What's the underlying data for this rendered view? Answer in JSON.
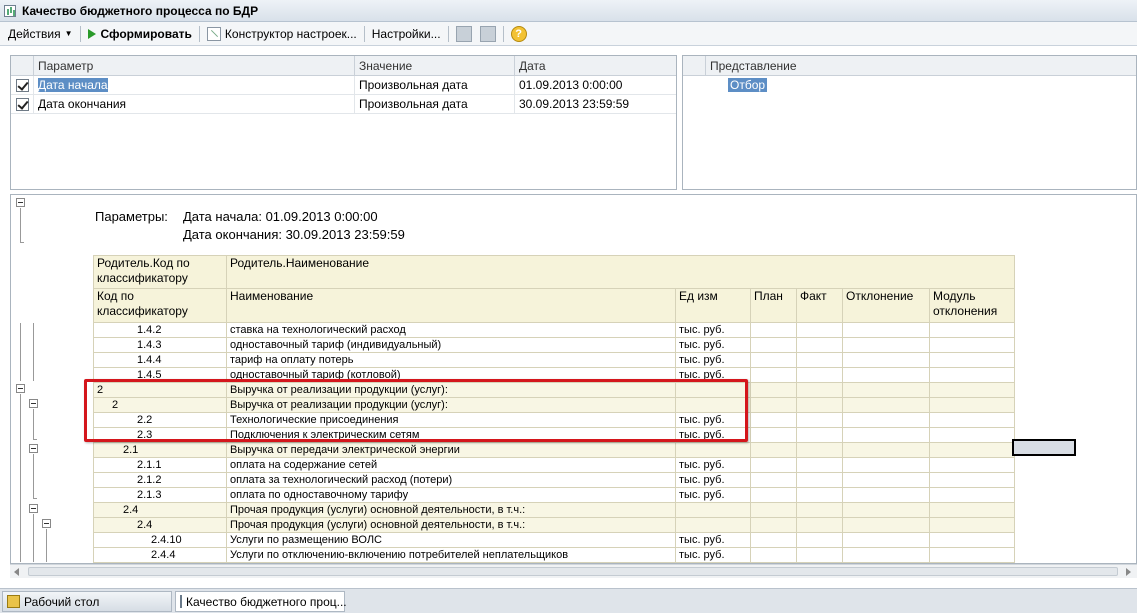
{
  "window": {
    "title": "Качество бюджетного процесса по БДР"
  },
  "toolbar": {
    "actions_label": "Действия",
    "generate_label": "Сформировать",
    "constructor_label": "Конструктор настроек...",
    "settings_label": "Настройки...",
    "help_label": "?"
  },
  "params": {
    "headers": {
      "param": "Параметр",
      "value": "Значение",
      "date": "Дата"
    },
    "rows": [
      {
        "name": "Дата начала",
        "value": "Произвольная дата",
        "date": "01.09.2013 0:00:00",
        "checked": true
      },
      {
        "name": "Дата окончания",
        "value": "Произвольная дата",
        "date": "30.09.2013 23:59:59",
        "checked": true
      }
    ]
  },
  "presentation": {
    "header": "Представление",
    "item": "Отбор"
  },
  "report": {
    "params_label": "Параметры:",
    "start_line": "Дата начала: 01.09.2013 0:00:00",
    "end_line": "Дата окончания: 30.09.2013 23:59:59",
    "header1": {
      "parent_code": "Родитель.Код по классификатору",
      "parent_name": "Родитель.Наименование"
    },
    "header2": {
      "code": "Код по классификатору",
      "name": "Наименование",
      "unit": "Ед изм",
      "plan": "План",
      "fact": "Факт",
      "deviation": "Отклонение",
      "module": "Модуль отклонения"
    },
    "rows": [
      {
        "code": "1.4.2",
        "name": "ставка на технологический расход",
        "unit": "тыс. руб.",
        "level": 3,
        "group": false
      },
      {
        "code": "1.4.3",
        "name": "одноставочный тариф (индивидуальный)",
        "unit": "тыс. руб.",
        "level": 3,
        "group": false
      },
      {
        "code": "1.4.4",
        "name": "тариф на оплату потерь",
        "unit": "тыс. руб.",
        "level": 3,
        "group": false
      },
      {
        "code": "1.4.5",
        "name": "одноставочный тариф (котловой)",
        "unit": "тыс. руб.",
        "level": 3,
        "group": false
      },
      {
        "code": "2",
        "name": "Выручка от реализации продукции (услуг):",
        "unit": "",
        "level": 0,
        "group": true
      },
      {
        "code": "2",
        "name": "Выручка от реализации продукции (услуг):",
        "unit": "",
        "level": 1,
        "group": true
      },
      {
        "code": "2.2",
        "name": "Технологические присоединения",
        "unit": "тыс. руб.",
        "level": 3,
        "group": false
      },
      {
        "code": "2.3",
        "name": "Подключения к электрическим сетям",
        "unit": "тыс. руб.",
        "level": 3,
        "group": false
      },
      {
        "code": "2.1",
        "name": "Выручка от передачи электрической энергии",
        "unit": "",
        "level": 2,
        "group": true
      },
      {
        "code": "2.1.1",
        "name": "оплата на содержание сетей",
        "unit": "тыс. руб.",
        "level": 3,
        "group": false
      },
      {
        "code": "2.1.2",
        "name": "оплата за технологический расход (потери)",
        "unit": "тыс. руб.",
        "level": 3,
        "group": false
      },
      {
        "code": "2.1.3",
        "name": "оплата по одноставочному тарифу",
        "unit": "тыс. руб.",
        "level": 3,
        "group": false
      },
      {
        "code": "2.4",
        "name": "Прочая  продукция (услуги) основной деятельности, в т.ч.:",
        "unit": "",
        "level": 2,
        "group": true
      },
      {
        "code": "2.4",
        "name": "Прочая  продукция (услуги) основной деятельности, в т.ч.:",
        "unit": "",
        "level": 3,
        "group": true
      },
      {
        "code": "2.4.10",
        "name": "Услуги по размещению ВОЛС",
        "unit": "тыс. руб.",
        "level": 4,
        "group": false
      },
      {
        "code": "2.4.4",
        "name": "Услуги по отключению-включению потребителей неплательщиков",
        "unit": "тыс. руб.",
        "level": 4,
        "group": false
      }
    ]
  },
  "taskbar": {
    "desktop_label": "Рабочий стол",
    "report_label": "Качество бюджетного проц..."
  }
}
